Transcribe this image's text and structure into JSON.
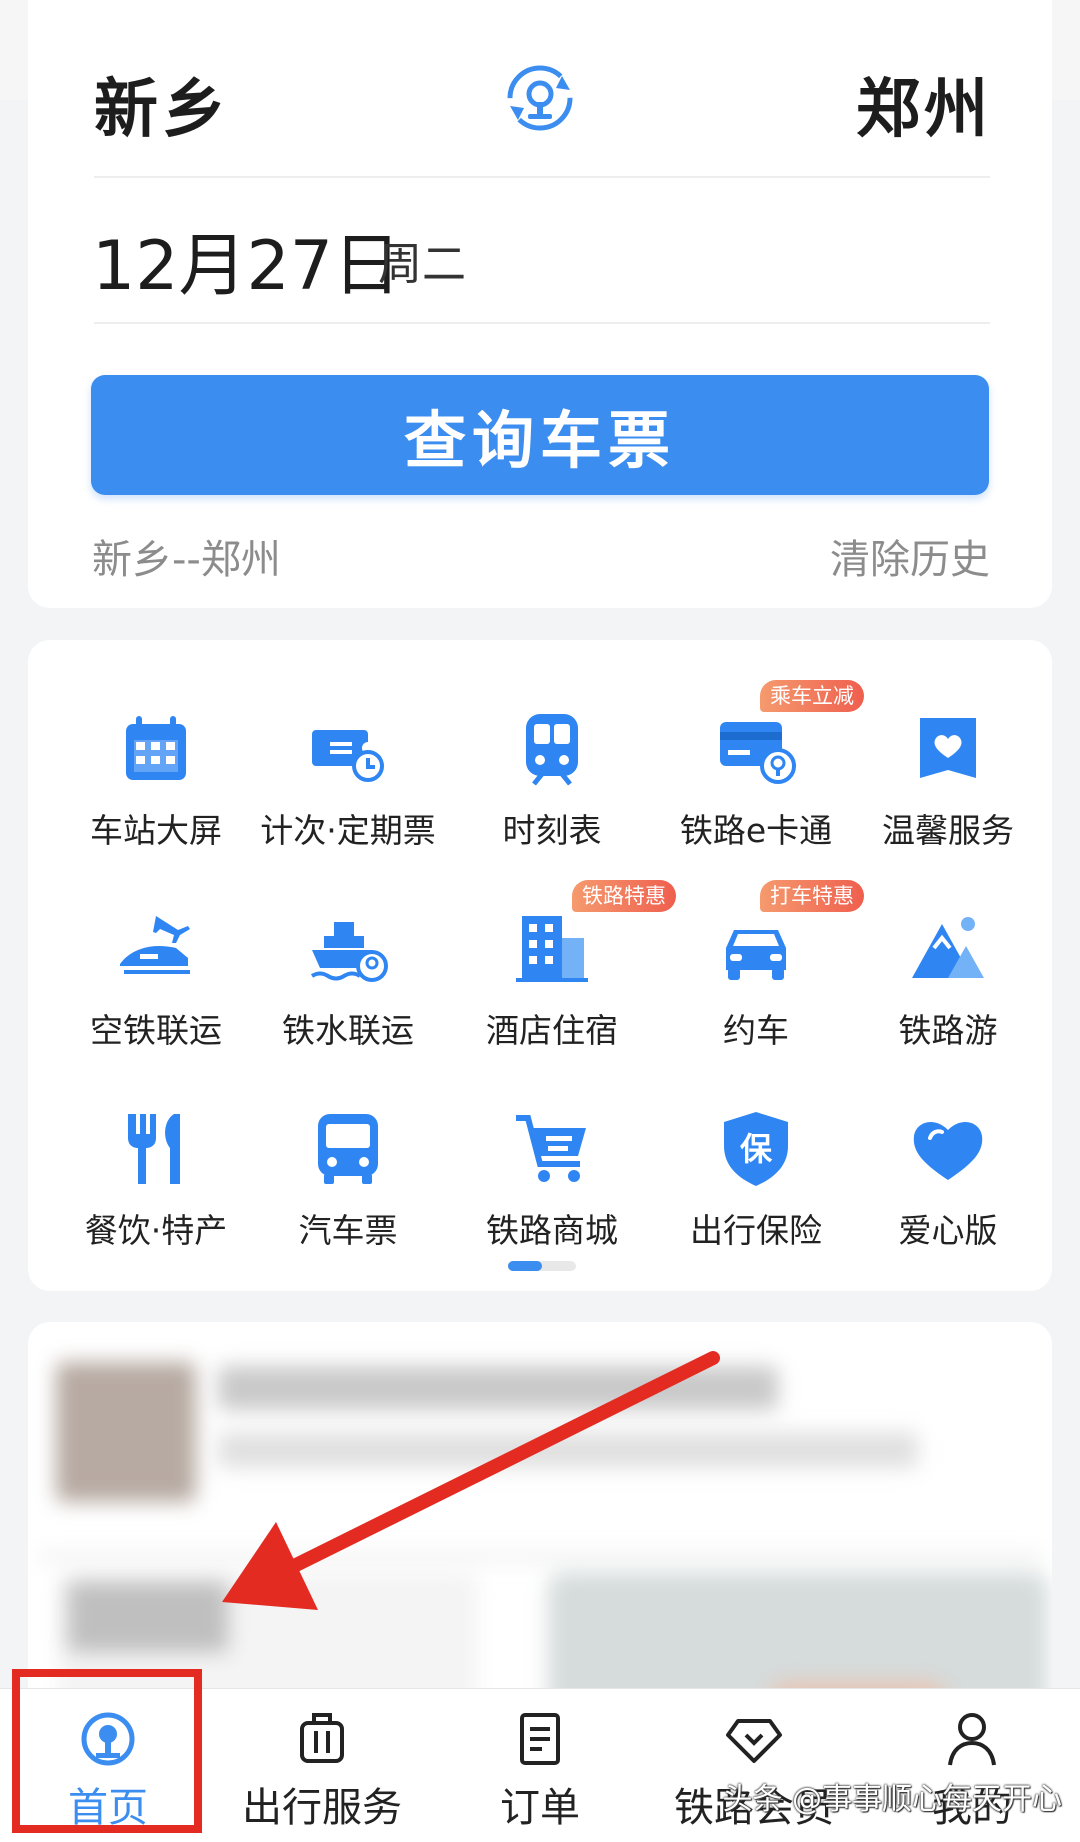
{
  "search": {
    "from_station": "新乡",
    "to_station": "郑州",
    "date": "12月27日",
    "weekday": "周二",
    "query_button": "查询车票",
    "history_item": "新乡--郑州",
    "clear_history": "清除历史"
  },
  "grid": {
    "items": [
      {
        "label": "车站大屏",
        "icon": "calendar-icon"
      },
      {
        "label": "计次·定期票",
        "icon": "ticket-clock-icon"
      },
      {
        "label": "时刻表",
        "icon": "train-icon"
      },
      {
        "label": "铁路e卡通",
        "icon": "card-icon",
        "badge": "乘车立减"
      },
      {
        "label": "温馨服务",
        "icon": "heart-bag-icon"
      },
      {
        "label": "空铁联运",
        "icon": "plane-train-icon"
      },
      {
        "label": "铁水联运",
        "icon": "ship-icon"
      },
      {
        "label": "酒店住宿",
        "icon": "hotel-icon",
        "badge": "铁路特惠"
      },
      {
        "label": "约车",
        "icon": "car-icon",
        "badge": "打车特惠"
      },
      {
        "label": "铁路游",
        "icon": "mountain-icon"
      },
      {
        "label": "餐饮·特产",
        "icon": "fork-knife-icon"
      },
      {
        "label": "汽车票",
        "icon": "bus-icon"
      },
      {
        "label": "铁路商城",
        "icon": "cart-icon"
      },
      {
        "label": "出行保险",
        "icon": "shield-icon",
        "shield_char": "保"
      },
      {
        "label": "爱心版",
        "icon": "heart-icon"
      }
    ]
  },
  "tabbar": {
    "tabs": [
      {
        "label": "首页",
        "icon": "railway-logo-icon",
        "active": true
      },
      {
        "label": "出行服务",
        "icon": "luggage-icon"
      },
      {
        "label": "订单",
        "icon": "order-icon"
      },
      {
        "label": "铁路会员",
        "icon": "diamond-icon"
      },
      {
        "label": "我的",
        "icon": "person-icon"
      }
    ]
  },
  "watermark": "头条 @事事顺心每天开心",
  "colors": {
    "accent": "#3c8df0",
    "annotation_red": "#e32b22",
    "badge": "#ef5f4e"
  }
}
